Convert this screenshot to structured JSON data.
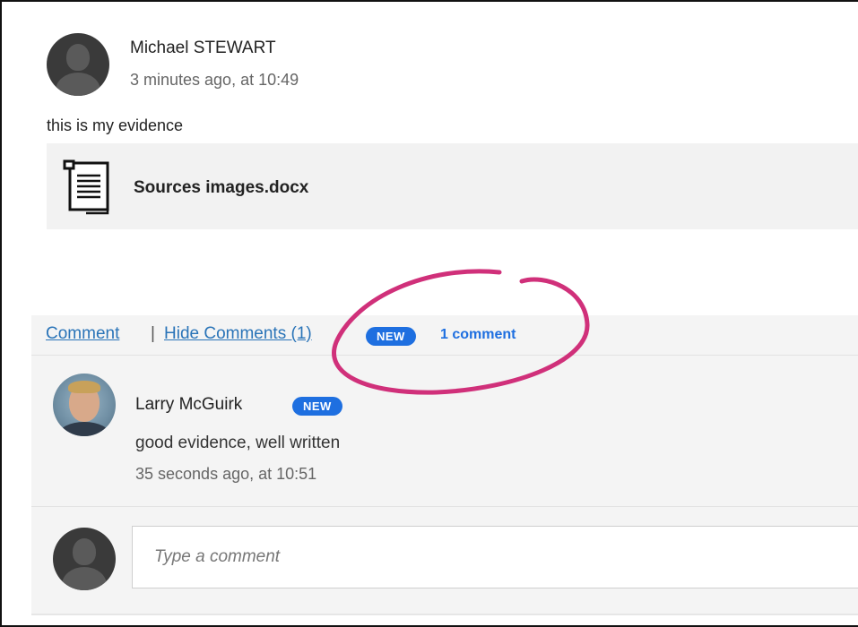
{
  "post": {
    "author": "Michael STEWART",
    "time": "3 minutes ago, at 10:49",
    "text": "this is my evidence",
    "attachment": {
      "name": "Sources images.docx",
      "icon": "document-icon"
    }
  },
  "actions": {
    "comment_label": "Comment",
    "separator": "|",
    "hide_comments_label": "Hide Comments (1)",
    "new_badge": "NEW",
    "new_comments_label": "1 comment"
  },
  "comments": [
    {
      "author": "Larry McGuirk",
      "badge": "NEW",
      "text": "good evidence, well written",
      "time": "35 seconds ago, at 10:51"
    }
  ],
  "composer": {
    "placeholder": "Type a comment"
  },
  "colors": {
    "accent": "#1e6fe0",
    "link": "#2a74b8",
    "annotation": "#d0307a"
  }
}
